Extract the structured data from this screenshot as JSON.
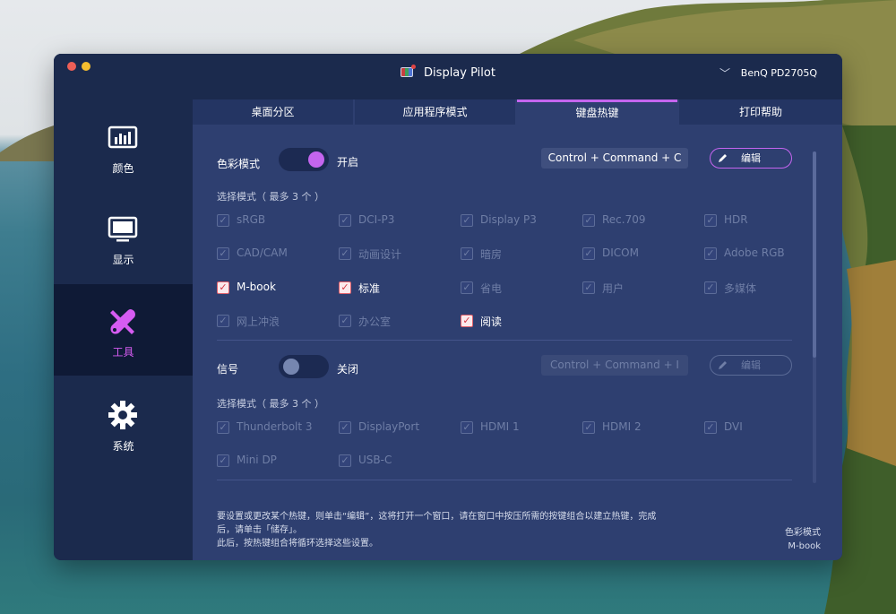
{
  "window": {
    "title": "Display Pilot",
    "monitor": "BenQ PD2705Q"
  },
  "sidebar": {
    "items": [
      {
        "label": "颜色",
        "icon": "color-chart-icon",
        "active": false
      },
      {
        "label": "显示",
        "icon": "monitor-icon",
        "active": false
      },
      {
        "label": "工具",
        "icon": "tools-icon",
        "active": true
      },
      {
        "label": "系统",
        "icon": "gear-icon",
        "active": false
      }
    ]
  },
  "tabs": [
    {
      "label": "桌面分区",
      "active": false
    },
    {
      "label": "应用程序模式",
      "active": false
    },
    {
      "label": "键盘热键",
      "active": true
    },
    {
      "label": "打印帮助",
      "active": false
    }
  ],
  "color_mode": {
    "title": "色彩模式",
    "toggle_state": "开启",
    "hotkey": "Control + Command + C",
    "edit_label": "编辑",
    "select_label": "选择模式（ 最多 3 个 ）",
    "options": [
      {
        "label": "sRGB",
        "checked": false
      },
      {
        "label": "DCI-P3",
        "checked": false
      },
      {
        "label": "Display P3",
        "checked": false
      },
      {
        "label": "Rec.709",
        "checked": false
      },
      {
        "label": "HDR",
        "checked": false
      },
      {
        "label": "CAD/CAM",
        "checked": false
      },
      {
        "label": "动画设计",
        "checked": false
      },
      {
        "label": "暗房",
        "checked": false
      },
      {
        "label": "DICOM",
        "checked": false
      },
      {
        "label": "Adobe RGB",
        "checked": false
      },
      {
        "label": "M-book",
        "checked": true
      },
      {
        "label": "标准",
        "checked": true
      },
      {
        "label": "省电",
        "checked": false
      },
      {
        "label": "用户",
        "checked": false
      },
      {
        "label": "多媒体",
        "checked": false
      },
      {
        "label": "网上冲浪",
        "checked": false
      },
      {
        "label": "办公室",
        "checked": false
      },
      {
        "label": "阅读",
        "checked": true
      }
    ]
  },
  "signal": {
    "title": "信号",
    "toggle_state": "关闭",
    "hotkey": "Control + Command + I",
    "edit_label": "编辑",
    "select_label": "选择模式（ 最多 3 个 ）",
    "options": [
      {
        "label": "Thunderbolt 3",
        "checked": false
      },
      {
        "label": "DisplayPort",
        "checked": false
      },
      {
        "label": "HDMI 1",
        "checked": false
      },
      {
        "label": "HDMI 2",
        "checked": false
      },
      {
        "label": "DVI",
        "checked": false
      },
      {
        "label": "Mini DP",
        "checked": false
      },
      {
        "label": "USB-C",
        "checked": false
      }
    ]
  },
  "footer": {
    "line1": "要设置或更改某个热键，则单击“编辑”，这将打开一个窗口，请在窗口中按压所需的按键组合以建立热键，完成",
    "line2": "后，请单击「储存」。",
    "line3": "此后，按热键组合将循环选择这些设置。"
  },
  "status": {
    "label": "色彩模式",
    "value": "M-book"
  },
  "colors": {
    "accent": "#c465ef",
    "window_bg": "#1b2a4d",
    "panel_bg": "#2e3f70",
    "check_red": "#d33845"
  }
}
